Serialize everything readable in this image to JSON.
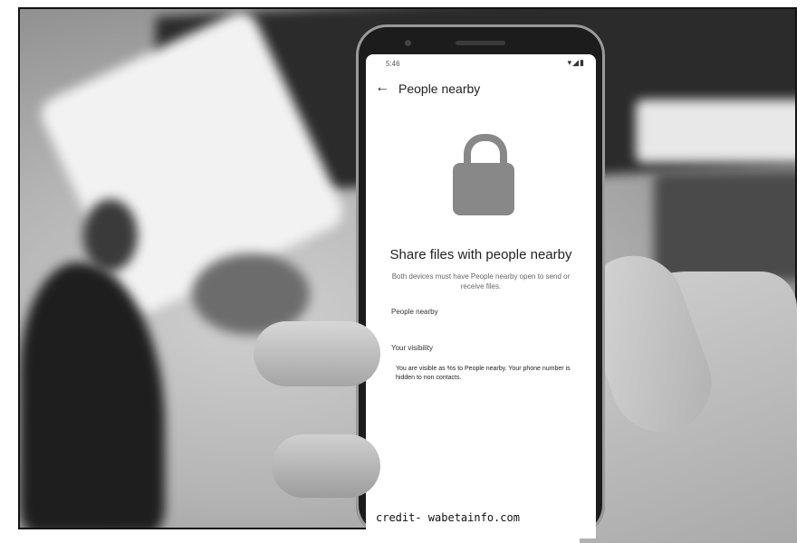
{
  "status_bar": {
    "time": "5:46",
    "icons": "▾◢▮"
  },
  "app_bar": {
    "back_icon": "←",
    "title": "People nearby"
  },
  "content": {
    "lock_icon": "lock-icon",
    "heading": "Share files with people nearby",
    "subtitle": "Both devices must have People nearby open to send or receive files.",
    "people_nearby_label": "People nearby",
    "your_visibility_label": "Your visibility",
    "visibility_text": "You are visible as %s to People nearby. Your phone number is hidden to non contacts."
  },
  "credit": "credit- wabetainfo.com"
}
